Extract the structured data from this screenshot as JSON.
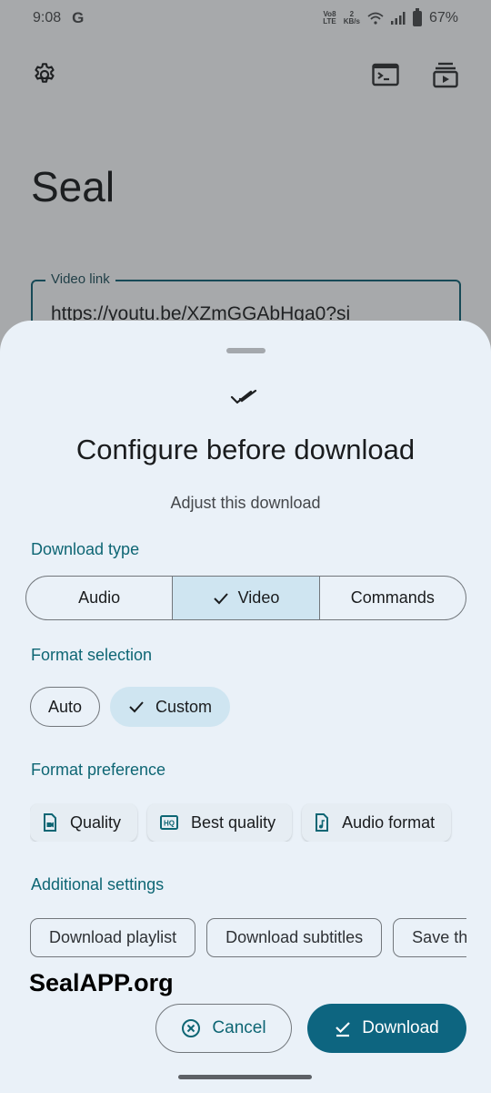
{
  "status_bar": {
    "time": "9:08",
    "google_icon": "G",
    "volte": "Vo8\nLTE",
    "net_speed_value": "2",
    "net_speed_unit": "KB/s",
    "battery": "67%"
  },
  "app": {
    "title": "Seal",
    "video_link_label": "Video link",
    "video_link_value": "https://youtu.be/XZmGGAbHga0?si",
    "icons": [
      "settings-icon",
      "terminal-icon",
      "download-queue-icon"
    ]
  },
  "sheet": {
    "icon": "done-all-icon",
    "title": "Configure before download",
    "subtitle": "Adjust this download",
    "download_type": {
      "label": "Download type",
      "options": [
        {
          "label": "Audio",
          "selected": false
        },
        {
          "label": "Video",
          "selected": true
        },
        {
          "label": "Commands",
          "selected": false
        }
      ]
    },
    "format_selection": {
      "label": "Format selection",
      "options": [
        {
          "label": "Auto",
          "selected": false
        },
        {
          "label": "Custom",
          "selected": true
        }
      ]
    },
    "format_preference": {
      "label": "Format preference",
      "items": [
        {
          "label": "Quality",
          "icon": "video-file-icon"
        },
        {
          "label": "Best quality",
          "icon": "hq-icon"
        },
        {
          "label": "Audio format",
          "icon": "audio-file-icon"
        }
      ]
    },
    "additional_settings": {
      "label": "Additional settings",
      "items": [
        "Download playlist",
        "Download subtitles",
        "Save thumbnail"
      ]
    },
    "watermark": "SealAPP.org",
    "cancel_label": "Cancel",
    "download_label": "Download"
  },
  "colors": {
    "accent": "#0e6674",
    "primary_button": "#0d6580",
    "selected_bg": "#cfe5f1",
    "sheet_bg": "#eaf1f8"
  }
}
